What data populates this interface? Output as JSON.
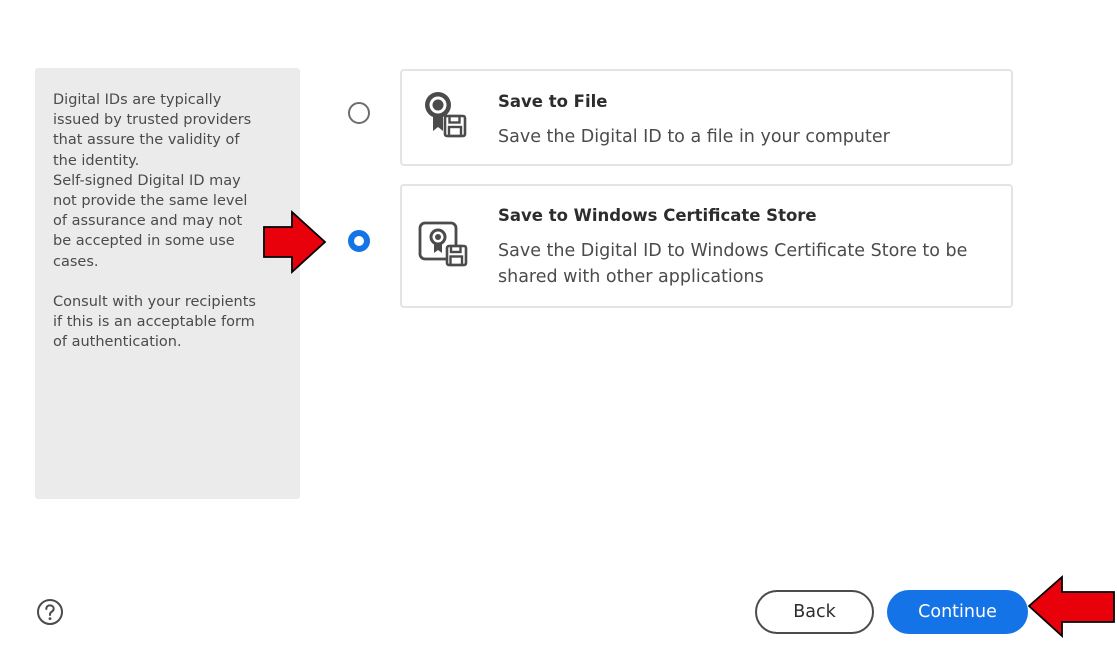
{
  "info": {
    "lines": [
      "Digital IDs are typically",
      "issued by trusted providers",
      "that assure the validity of",
      "the identity.",
      "Self-signed Digital ID may",
      "not provide the same level",
      "of assurance and may not",
      "be accepted in some use",
      "cases."
    ],
    "consult_lines": [
      "Consult with your recipients",
      "if this is an acceptable form",
      "of authentication."
    ]
  },
  "options": [
    {
      "title": "Save to File",
      "description": "Save the Digital ID to a file in your computer",
      "selected": false,
      "icon": "certificate-file-icon"
    },
    {
      "title": "Save to Windows Certificate Store",
      "description": "Save the Digital ID to Windows Certificate Store to be shared with other applications",
      "selected": true,
      "icon": "certificate-store-icon"
    }
  ],
  "footer": {
    "help_icon": "help-circle-icon",
    "back_label": "Back",
    "continue_label": "Continue"
  },
  "colors": {
    "accent": "#1473e6",
    "panel": "#ebebeb",
    "annotation": "#e8000b"
  }
}
